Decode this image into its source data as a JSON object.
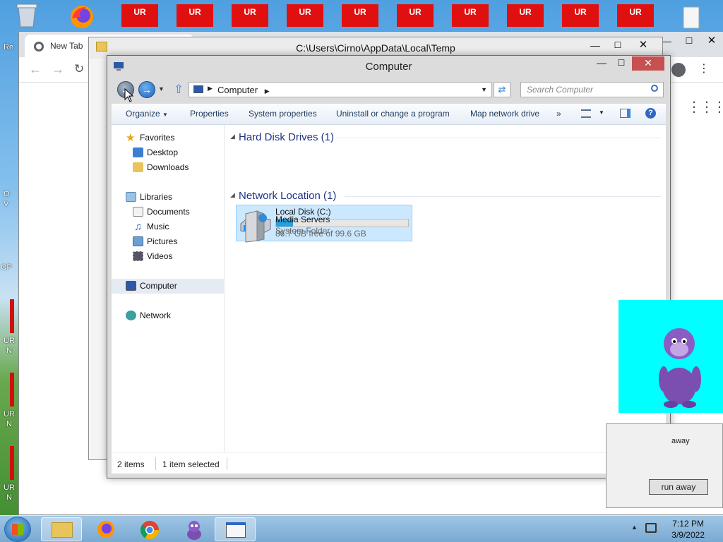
{
  "desktop": {
    "ur_labels": [
      "UR",
      "UR",
      "UR",
      "UR",
      "UR",
      "UR",
      "UR",
      "UR",
      "UR",
      "UR"
    ],
    "left_texts": [
      "Re",
      "O",
      "V",
      "OP",
      "UR",
      "N",
      "UR",
      "N",
      "UR",
      "N"
    ],
    "runaway": {
      "label": "away",
      "button": "run away"
    }
  },
  "chrome": {
    "tab_title": "New Tab",
    "apps_icon": "apps-grid-icon",
    "profile_icon": "profile-icon",
    "left_status": "3"
  },
  "temp_window": {
    "title": "C:\\Users\\Cirno\\AppData\\Local\\Temp"
  },
  "explorer": {
    "title": "Computer",
    "address": {
      "segments": [
        "Computer"
      ]
    },
    "search_placeholder": "Search Computer",
    "commands": [
      "Organize",
      "Properties",
      "System properties",
      "Uninstall or change a program",
      "Map network drive"
    ],
    "more": "»",
    "nav": {
      "favorites": {
        "label": "Favorites",
        "items": [
          "Desktop",
          "Downloads"
        ]
      },
      "libraries": {
        "label": "Libraries",
        "items": [
          "Documents",
          "Music",
          "Pictures",
          "Videos"
        ]
      },
      "computer": "Computer",
      "network": "Network"
    },
    "groups": [
      {
        "label": "Hard Disk Drives (1)"
      },
      {
        "label": "Network Location (1)"
      }
    ],
    "drive": {
      "name": "Local Disk (C:)",
      "free_text": "86.7 GB free of 99.6 GB",
      "used_fraction": 0.13
    },
    "media": {
      "name": "Media Servers",
      "type": "System Folder"
    },
    "status": {
      "items": "2 items",
      "selected": "1 item selected"
    }
  },
  "taskbar": {
    "time": "7:12 PM",
    "date": "3/9/2022"
  }
}
